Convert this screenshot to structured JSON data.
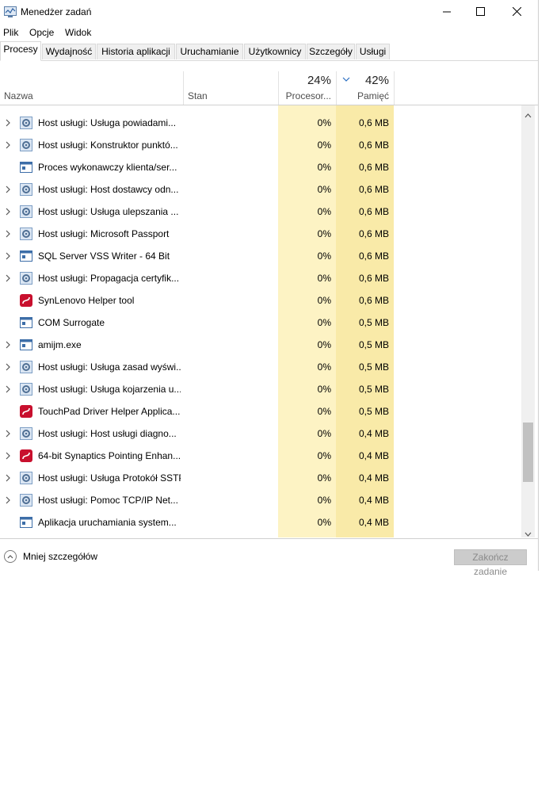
{
  "window": {
    "title": "Menedżer zadań",
    "controls": {
      "minimize": "minimize-icon",
      "maximize": "maximize-icon",
      "close": "close-icon"
    }
  },
  "menu": [
    "Plik",
    "Opcje",
    "Widok"
  ],
  "tabs": [
    {
      "label": "Procesy",
      "active": true
    },
    {
      "label": "Wydajność"
    },
    {
      "label": "Historia aplikacji"
    },
    {
      "label": "Uruchamianie"
    },
    {
      "label": "Użytkownicy"
    },
    {
      "label": "Szczegóły"
    },
    {
      "label": "Usługi"
    }
  ],
  "columns": {
    "name": "Nazwa",
    "status": "Stan",
    "cpu": {
      "percent": "24%",
      "label": "Procesor..."
    },
    "memory": {
      "percent": "42%",
      "label": "Pamięć",
      "sorted": "descending"
    }
  },
  "colors": {
    "cpu_bg": "#fdf3c4",
    "mem_bg": "#f9eaa8",
    "scroll_thumb": "#c1c1c1"
  },
  "processes": [
    {
      "name": "Host usługi: Usługa powiadami...",
      "cpu": "0%",
      "mem": "0,6 MB",
      "icon": "gear-icon",
      "expandable": true
    },
    {
      "name": "Host usługi: Konstruktor punktó...",
      "cpu": "0%",
      "mem": "0,6 MB",
      "icon": "gear-icon",
      "expandable": true
    },
    {
      "name": "Proces wykonawczy klienta/ser...",
      "cpu": "0%",
      "mem": "0,6 MB",
      "icon": "window-icon",
      "expandable": false
    },
    {
      "name": "Host usługi: Host dostawcy odn...",
      "cpu": "0%",
      "mem": "0,6 MB",
      "icon": "gear-icon",
      "expandable": true
    },
    {
      "name": "Host usługi: Usługa ulepszania ...",
      "cpu": "0%",
      "mem": "0,6 MB",
      "icon": "gear-icon",
      "expandable": true
    },
    {
      "name": "Host usługi: Microsoft Passport",
      "cpu": "0%",
      "mem": "0,6 MB",
      "icon": "gear-icon",
      "expandable": true
    },
    {
      "name": "SQL Server VSS Writer - 64 Bit",
      "cpu": "0%",
      "mem": "0,6 MB",
      "icon": "window-icon",
      "expandable": true
    },
    {
      "name": "Host usługi: Propagacja certyfik...",
      "cpu": "0%",
      "mem": "0,6 MB",
      "icon": "gear-icon",
      "expandable": true
    },
    {
      "name": "SynLenovo Helper tool",
      "cpu": "0%",
      "mem": "0,6 MB",
      "icon": "synaptics-icon",
      "expandable": false
    },
    {
      "name": "COM Surrogate",
      "cpu": "0%",
      "mem": "0,5 MB",
      "icon": "window-icon",
      "expandable": false
    },
    {
      "name": "amijm.exe",
      "cpu": "0%",
      "mem": "0,5 MB",
      "icon": "window-icon",
      "expandable": true
    },
    {
      "name": "Host usługi: Usługa zasad wyświ...",
      "cpu": "0%",
      "mem": "0,5 MB",
      "icon": "gear-icon",
      "expandable": true
    },
    {
      "name": "Host usługi: Usługa kojarzenia u...",
      "cpu": "0%",
      "mem": "0,5 MB",
      "icon": "gear-icon",
      "expandable": true
    },
    {
      "name": "TouchPad Driver Helper Applica...",
      "cpu": "0%",
      "mem": "0,5 MB",
      "icon": "synaptics-icon",
      "expandable": false
    },
    {
      "name": "Host usługi: Host usługi diagno...",
      "cpu": "0%",
      "mem": "0,4 MB",
      "icon": "gear-icon",
      "expandable": true
    },
    {
      "name": "64-bit Synaptics Pointing Enhan...",
      "cpu": "0%",
      "mem": "0,4 MB",
      "icon": "synaptics-icon",
      "expandable": true
    },
    {
      "name": "Host usługi: Usługa Protokół SSTP",
      "cpu": "0%",
      "mem": "0,4 MB",
      "icon": "gear-icon",
      "expandable": true
    },
    {
      "name": "Host usługi: Pomoc TCP/IP Net...",
      "cpu": "0%",
      "mem": "0,4 MB",
      "icon": "gear-icon",
      "expandable": true
    },
    {
      "name": "Aplikacja uruchamiania system...",
      "cpu": "0%",
      "mem": "0,4 MB",
      "icon": "window-icon",
      "expandable": false
    }
  ],
  "footer": {
    "fewer_details": "Mniej szczegółów",
    "end_task": "Zakończ zadanie"
  }
}
